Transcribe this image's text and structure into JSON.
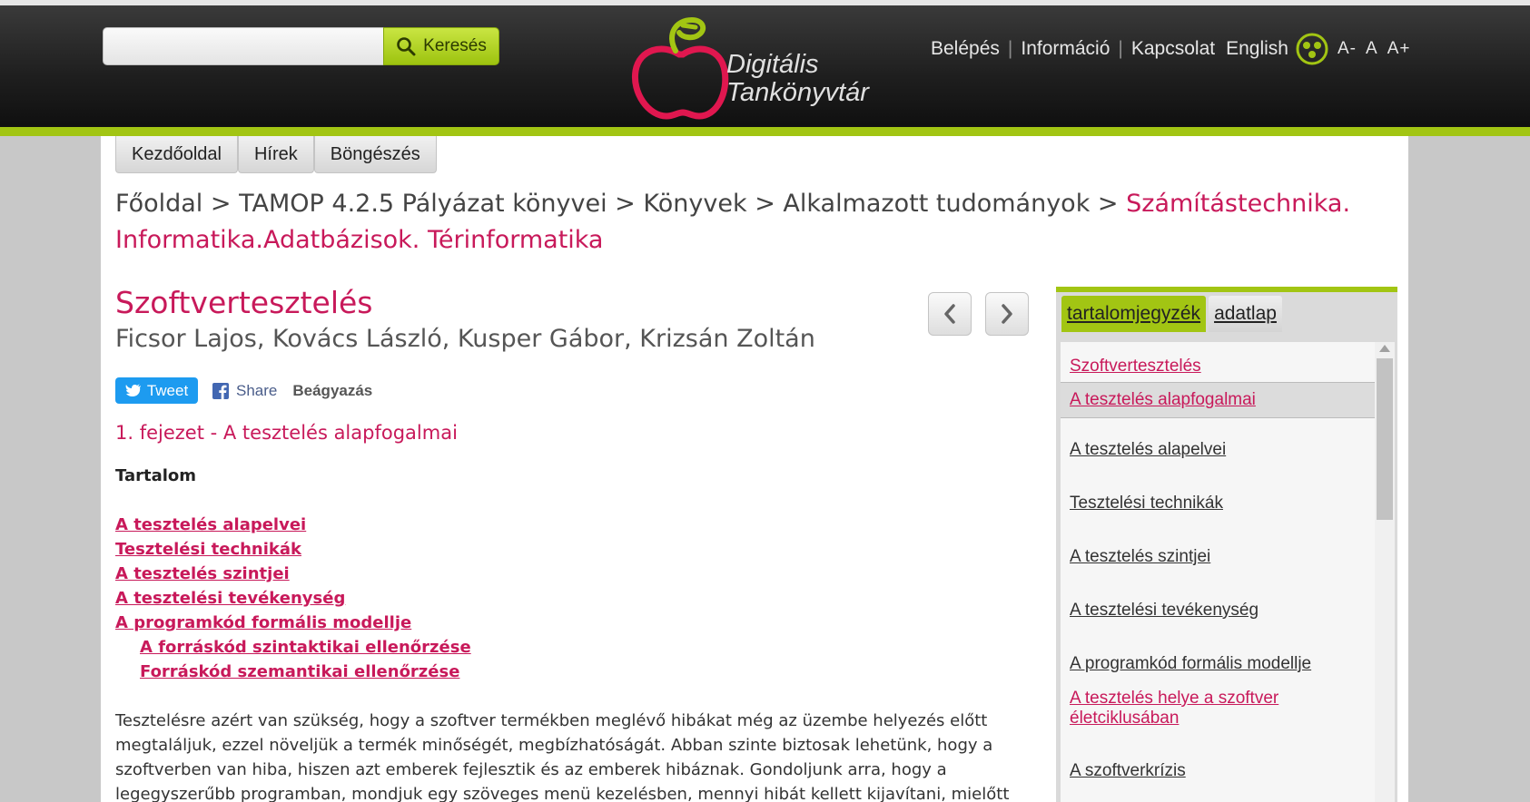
{
  "header": {
    "search_placeholder": "",
    "search_button_label": "Keresés",
    "logo_line1": "Digitális",
    "logo_line2": "Tankönyvtár",
    "nav": {
      "login": "Belépés",
      "info": "Információ",
      "contact": "Kapcsolat",
      "english": "English",
      "font_smaller": "A-",
      "font_normal": "A",
      "font_larger": "A+"
    }
  },
  "tabs": [
    "Kezdőoldal",
    "Hírek",
    "Böngészés"
  ],
  "breadcrumb": {
    "items": [
      "Főoldal",
      "TAMOP 4.2.5 Pályázat könyvei",
      "Könyvek",
      "Alkalmazott tudományok"
    ],
    "separator": ">",
    "current": "Számítástechnika. Informatika.Adatbázisok. Térinformatika"
  },
  "book": {
    "title": "Szoftvertesztelés",
    "authors": "Ficsor Lajos, Kovács László, Kusper Gábor, Krizsán Zoltán"
  },
  "social": {
    "tweet": "Tweet",
    "share": "Share",
    "embed": "Beágyazás"
  },
  "chapter": {
    "title": "1. fejezet - A tesztelés alapfogalmai",
    "contents_heading": "Tartalom",
    "toc": [
      "A tesztelés alapelvei",
      "Tesztelési technikák",
      "A tesztelés szintjei",
      "A tesztelési tevékenység",
      "A programkód formális modellje",
      "A forráskód szintaktikai ellenőrzése",
      "Forráskód szemantikai ellenőrzése"
    ],
    "body_lines": [
      "Tesztelésre azért van szükség, hogy a szoftver termékben meglévő hibákat még az üzembe helyezés előtt",
      "megtaláljuk, ezzel növeljük a termék minőségét, megbízhatóságát. Abban szinte biztosak lehetünk, hogy a",
      "szoftverben van hiba, hiszen azt emberek fejlesztik és az emberek hibáznak. Gondoljunk arra, hogy a",
      "legegyszerűbb programban, mondjuk egy szöveges menü kezelésben, mennyi hibát kellett kijavítani, mielőtt"
    ]
  },
  "sidebar": {
    "tab_toc": "tartalomjegyzék",
    "tab_data": "adatlap",
    "items": [
      "Szoftvertesztelés",
      "A tesztelés alapfogalmai",
      "A tesztelés alapelvei",
      "Tesztelési technikák",
      "A tesztelés szintjei",
      "A tesztelési tevékenység",
      "A programkód formális modellje",
      "A tesztelés helye a szoftver",
      "életciklusában",
      "A szoftverkrízis"
    ]
  },
  "colors": {
    "accent_green": "#a2c513",
    "link_pink": "#c8195a",
    "twitter_blue": "#1d9bf0"
  },
  "icons": [
    "search-icon",
    "apple-logo-icon",
    "accessibility-icon",
    "chevron-left-icon",
    "chevron-right-icon",
    "twitter-bird-icon",
    "facebook-icon"
  ]
}
